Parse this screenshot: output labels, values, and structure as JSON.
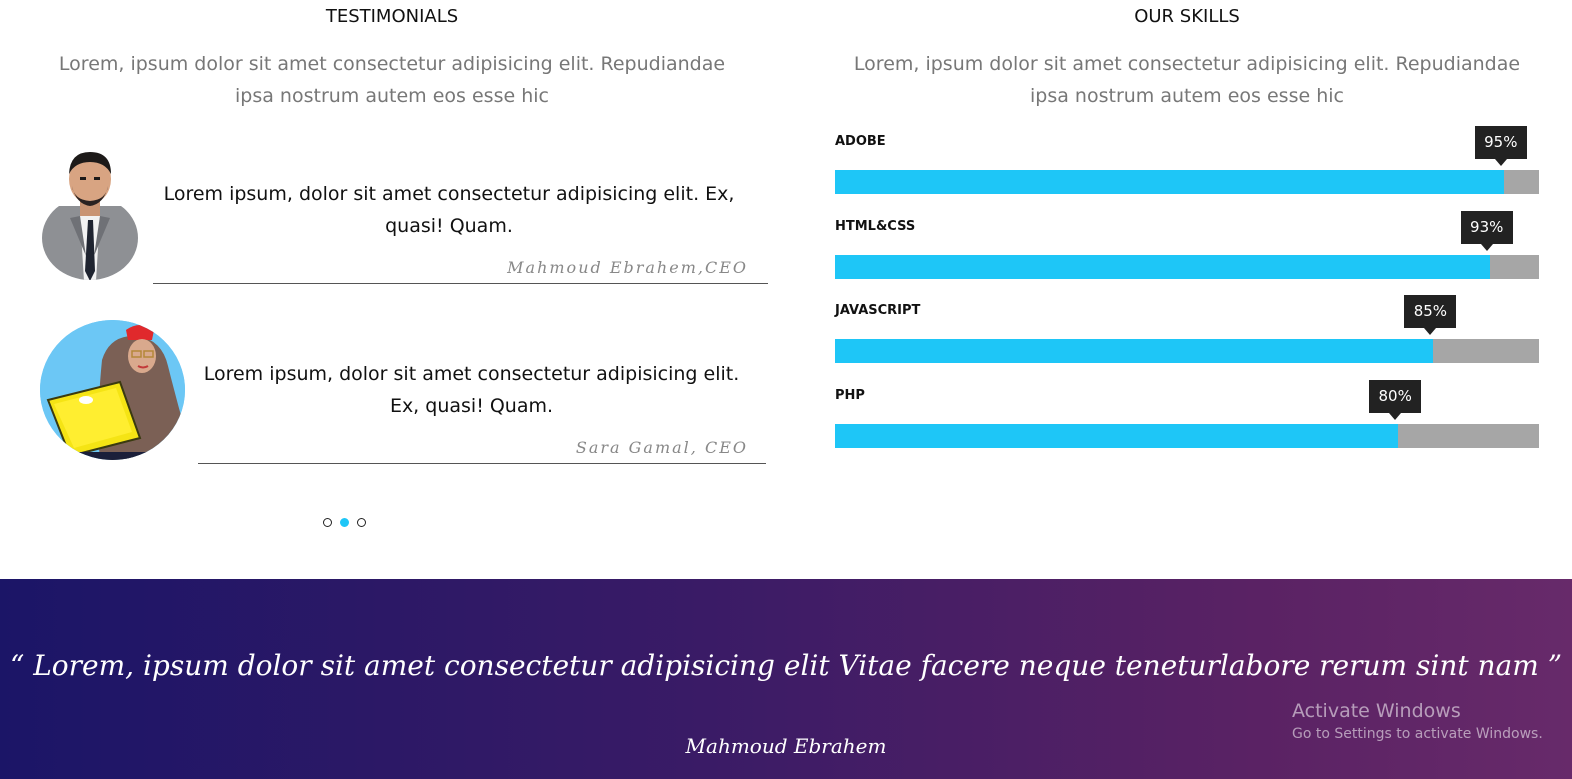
{
  "testimonials": {
    "title": "TESTIMONIALS",
    "subtitle": "Lorem, ipsum dolor sit amet consectetur adipisicing elit. Repudiandae ipsa nostrum autem eos esse hic",
    "items": [
      {
        "text": "Lorem ipsum, dolor sit amet consectetur adipisicing elit. Ex, quasi! Quam.",
        "author": "Mahmoud Ebrahem,CEO"
      },
      {
        "text": "Lorem ipsum, dolor sit amet consectetur adipisicing elit. Ex, quasi! Quam.",
        "author": "Sara Gamal, CEO"
      }
    ],
    "dots": {
      "count": 3,
      "active": 2
    }
  },
  "skills": {
    "title": "OUR SKILLS",
    "subtitle": "Lorem, ipsum dolor sit amet consectetur adipisicing elit. Repudiandae ipsa nostrum autem eos esse hic",
    "items": [
      {
        "name": "ADOBE",
        "percent": 95,
        "label": "95%"
      },
      {
        "name": "HTML&CSS",
        "percent": 93,
        "label": "93%"
      },
      {
        "name": "JAVASCRIPT",
        "percent": 85,
        "label": "85%"
      },
      {
        "name": "PHP",
        "percent": 80,
        "label": "80%"
      }
    ],
    "colors": {
      "fill": "#1ec6f7",
      "track": "#a6a6a6",
      "tooltip": "#222222"
    }
  },
  "banner": {
    "quote": "“ Lorem, ipsum dolor sit amet consectetur adipisicing elit Vitae facere neque teneturlabore rerum sint nam ”",
    "author": "Mahmoud Ebrahem"
  },
  "watermark": {
    "line1": "Activate Windows",
    "line2": "Go to Settings to activate Windows."
  }
}
